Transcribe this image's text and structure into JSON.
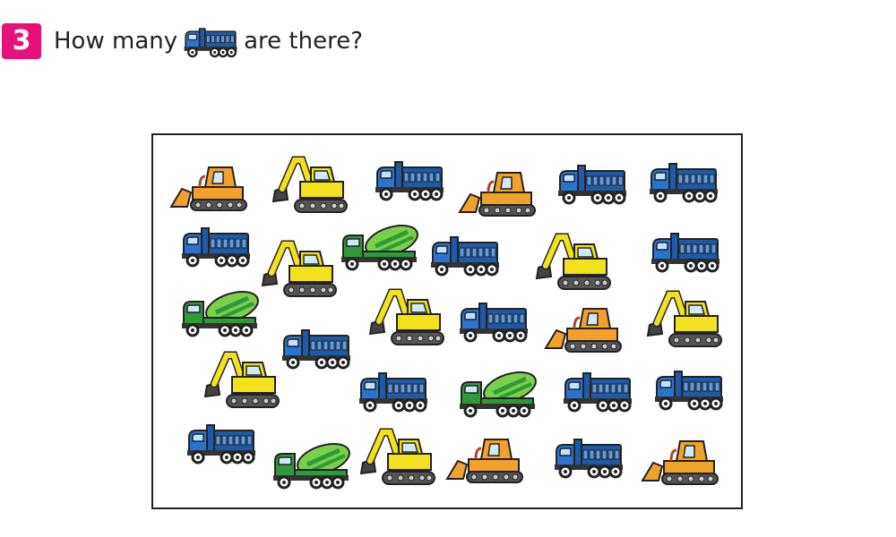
{
  "question": {
    "number": "3",
    "prefix": "How many",
    "suffix": "are there?",
    "target_icon": "dump-truck-icon"
  },
  "colors": {
    "accent": "#e8117a",
    "dump_truck": "#1f5aa6",
    "bulldozer": "#f2a12a",
    "excavator": "#f2e21d",
    "mixer": "#2f9a3a"
  },
  "vehicles": [
    {
      "type": "bulldozer"
    },
    {
      "type": "excavator"
    },
    {
      "type": "dump-truck"
    },
    {
      "type": "bulldozer"
    },
    {
      "type": "dump-truck"
    },
    {
      "type": "dump-truck"
    },
    {
      "type": "dump-truck"
    },
    {
      "type": "excavator"
    },
    {
      "type": "mixer-truck"
    },
    {
      "type": "dump-truck"
    },
    {
      "type": "excavator"
    },
    {
      "type": "dump-truck"
    },
    {
      "type": "mixer-truck"
    },
    {
      "type": "excavator"
    },
    {
      "type": "dump-truck"
    },
    {
      "type": "bulldozer"
    },
    {
      "type": "excavator"
    },
    {
      "type": "dump-truck"
    },
    {
      "type": "excavator"
    },
    {
      "type": "dump-truck"
    },
    {
      "type": "mixer-truck"
    },
    {
      "type": "dump-truck"
    },
    {
      "type": "dump-truck"
    },
    {
      "type": "dump-truck"
    },
    {
      "type": "mixer-truck"
    },
    {
      "type": "excavator"
    },
    {
      "type": "bulldozer"
    },
    {
      "type": "dump-truck"
    },
    {
      "type": "bulldozer"
    }
  ]
}
